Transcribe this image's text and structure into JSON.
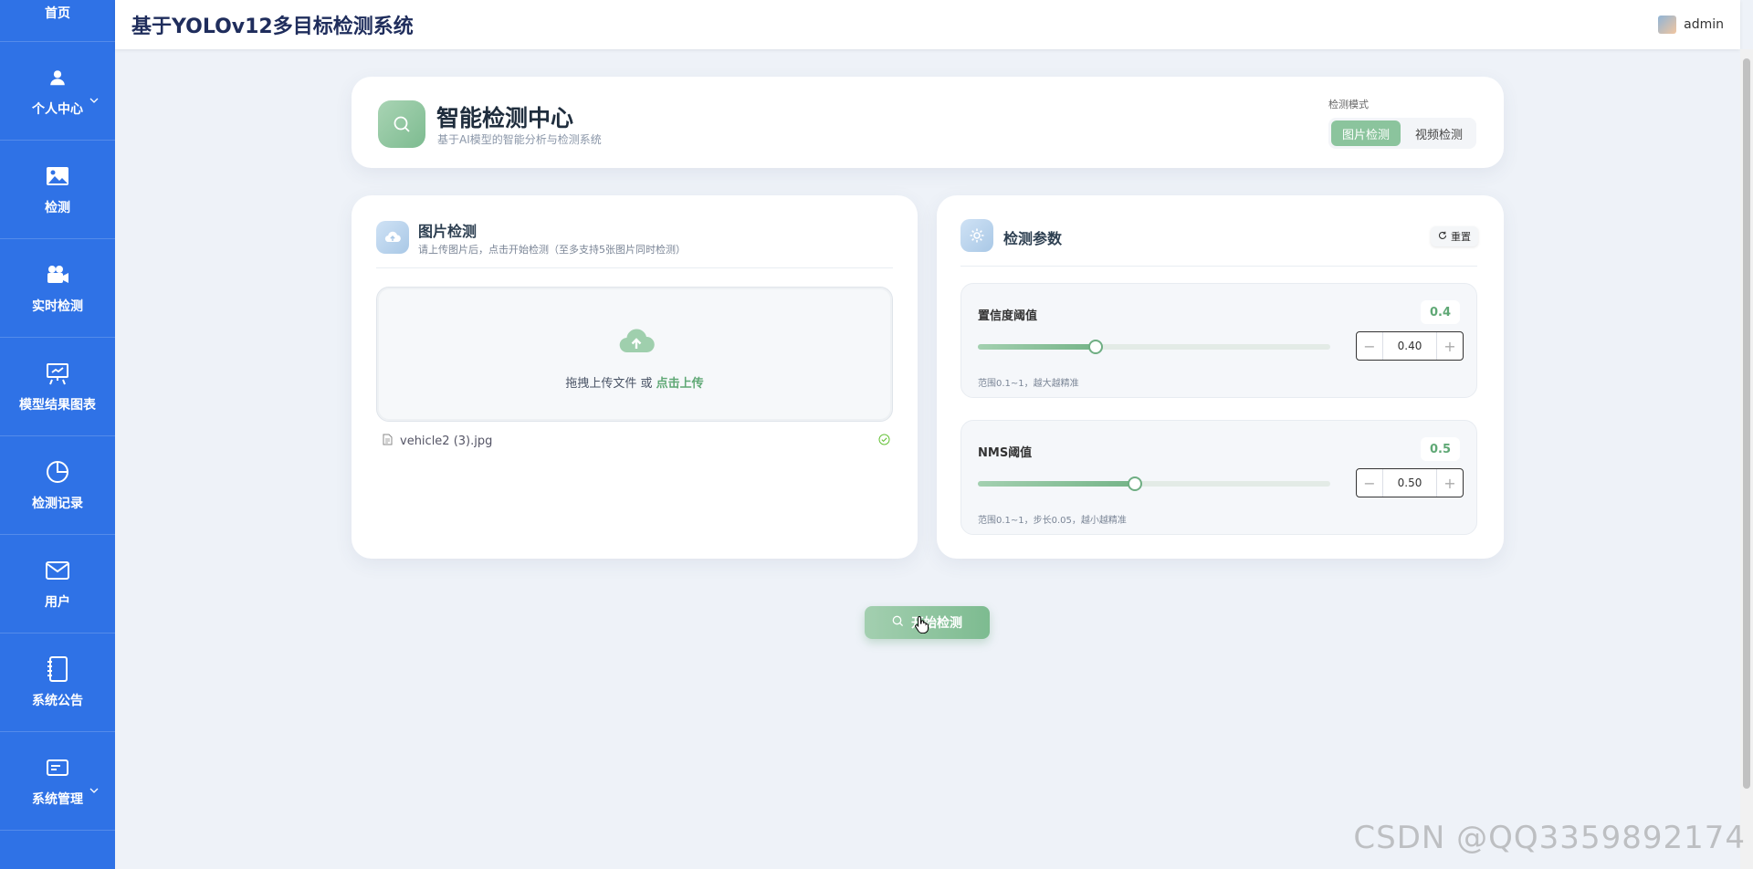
{
  "sidebar": {
    "items": [
      {
        "label": "首页",
        "icon": "home-icon"
      },
      {
        "label": "个人中心",
        "icon": "user-icon",
        "expandable": true
      },
      {
        "label": "检测",
        "icon": "image-icon"
      },
      {
        "label": "实时检测",
        "icon": "camera-icon"
      },
      {
        "label": "模型结果图表",
        "icon": "chart-board-icon"
      },
      {
        "label": "检测记录",
        "icon": "pie-chart-icon"
      },
      {
        "label": "用户",
        "icon": "mail-icon"
      },
      {
        "label": "系统公告",
        "icon": "notebook-icon"
      },
      {
        "label": "系统管理",
        "icon": "settings-card-icon",
        "expandable": true
      }
    ]
  },
  "header": {
    "title": "基于YOLOv12多目标检测系统",
    "username": "admin"
  },
  "center": {
    "title": "智能检测中心",
    "subtitle": "基于AI模型的智能分析与检测系统",
    "mode_label": "检测模式",
    "modes": [
      "图片检测",
      "视频检测"
    ],
    "active_mode": "图片检测"
  },
  "upload": {
    "title": "图片检测",
    "subtitle": "请上传图片后，点击开始检测（至多支持5张图片同时检测）",
    "drop_text": "拖拽上传文件 或 ",
    "drop_link": "点击上传",
    "file_name": "vehicle2 (3).jpg"
  },
  "params": {
    "title": "检测参数",
    "reset_label": "重置",
    "confidence": {
      "name": "置信度阈值",
      "badge": "0.4",
      "value": 0.4,
      "value_text": "0.40",
      "min": 0.1,
      "max": 1,
      "hint": "范围0.1~1，越大越精准"
    },
    "nms": {
      "name": "NMS阈值",
      "badge": "0.5",
      "value": 0.5,
      "value_text": "0.50",
      "min": 0.1,
      "max": 1,
      "hint": "范围0.1~1，步长0.05，越小越精准"
    }
  },
  "start_button": "开始检测",
  "watermark": "CSDN @QQ3359892174",
  "colors": {
    "sidebar": "#2f72e6",
    "accent_green": "#7dbb90",
    "background": "#eef2f8"
  }
}
